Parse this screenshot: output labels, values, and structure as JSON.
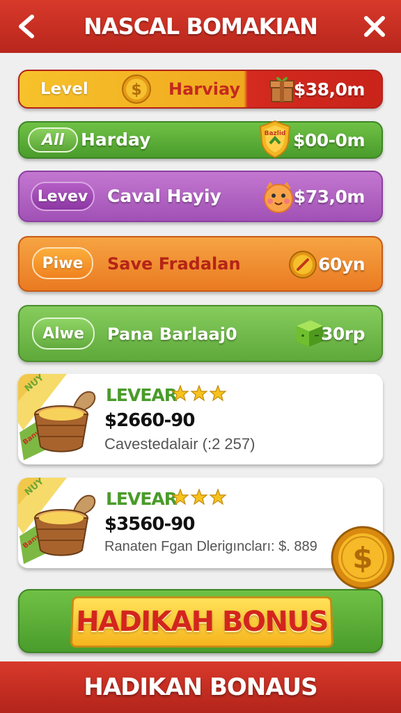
{
  "header": {
    "title": "NASCAL BOMAKIAN"
  },
  "rows": [
    {
      "tag": "Level",
      "name": "Harviay",
      "amount": "$38,0m",
      "icon": "gift-box-icon",
      "coin_icon": "dollar-coin-icon"
    },
    {
      "tag": "All",
      "name": "Harday",
      "amount": "$00-0m",
      "icon": "shield-badge-icon",
      "badge_text": "Bazlid"
    },
    {
      "tag": "Levev",
      "name": "Caval Hayiy",
      "amount": "$73,0m",
      "icon": "cat-face-icon"
    },
    {
      "tag": "Piwe",
      "name": "Save Fradalan",
      "amount": "60yn",
      "icon": "pencil-coin-icon"
    },
    {
      "tag": "Alwe",
      "name": "Pana Barlaaj0",
      "amount": "30rp",
      "icon": "green-cube-icon"
    }
  ],
  "cards": [
    {
      "ribbon_top": "NUY",
      "ribbon_bottom": "Banw\nMy",
      "level": "LEVEAR",
      "stars": 3,
      "price": "$2660-90",
      "desc": "Cavestedalair (:2 257)"
    },
    {
      "ribbon_top": "NUY",
      "ribbon_bottom": "Banw\nMy",
      "level": "LEVEAR",
      "stars": 3,
      "price": "$3560-90",
      "desc": "Ranaten Fgan Dlerigıncları: $. 889"
    }
  ],
  "bonus": {
    "label": "HADIKAH BONUS"
  },
  "footer": {
    "label": "HADIKAN BONAUS"
  },
  "colors": {
    "header_red": "#c52d20",
    "green": "#5aae38",
    "purple": "#b062c2",
    "orange": "#ef8b2c",
    "gold": "#f6b51e"
  }
}
